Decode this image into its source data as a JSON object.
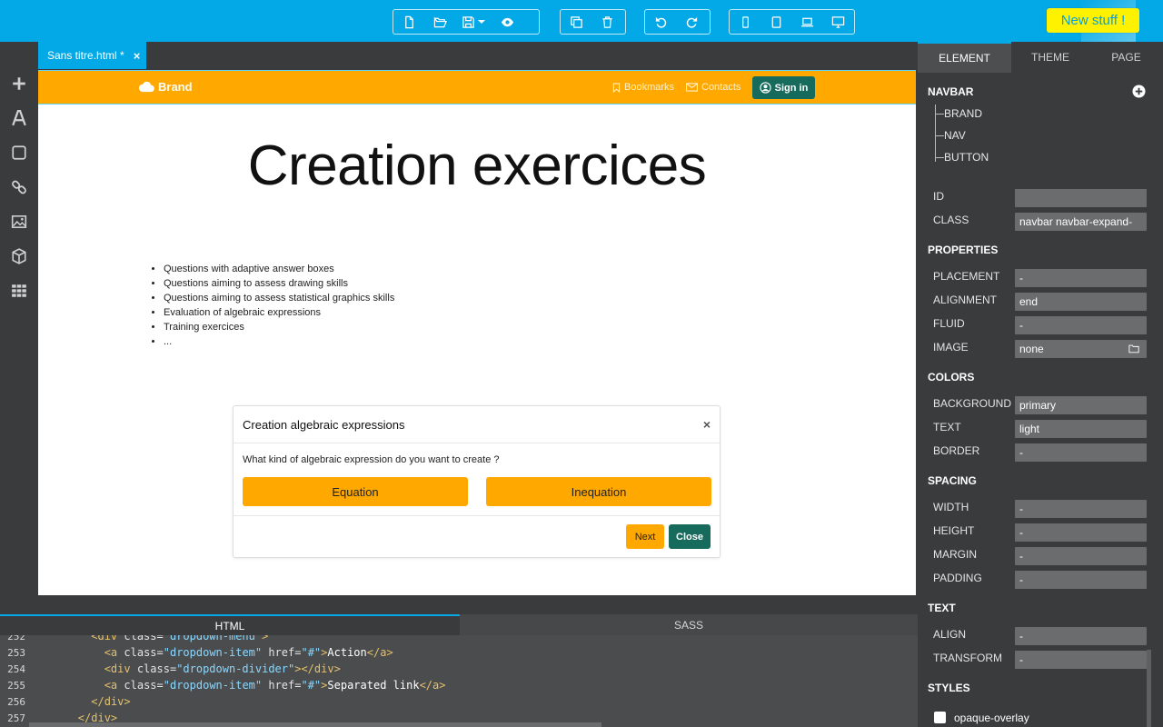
{
  "toolbar": {
    "new_stuff": "New stuff !"
  },
  "file_tab": {
    "name": "Sans titre.html *",
    "close": "×"
  },
  "navbar": {
    "brand": "Brand",
    "links": [
      "Bookmarks",
      "Contacts"
    ],
    "signin": "Sign in"
  },
  "hero": {
    "title": "Creation exercices"
  },
  "bullets": [
    "Questions with adaptive answer boxes",
    "Questions aiming to assess drawing skills",
    "Questions aiming to assess statistical graphics skills",
    "Evaluation of algebraic expressions",
    "Training exercices",
    "..."
  ],
  "modal": {
    "title": "Creation algebraic expressions",
    "close": "×",
    "question": "What kind of algebraic expression do you want to create ?",
    "choices": [
      "Equation",
      "Inequation"
    ],
    "next": "Next",
    "close_btn": "Close"
  },
  "editor": {
    "tabs": [
      "HTML",
      "SASS"
    ],
    "lines": [
      {
        "n": "252",
        "indent": "          ",
        "parts": [
          [
            "tag",
            "<div "
          ],
          [
            "attr",
            "class="
          ],
          [
            "str",
            "\"dropdown-menu\""
          ],
          [
            "tag",
            ">"
          ]
        ]
      },
      {
        "n": "253",
        "indent": "            ",
        "parts": [
          [
            "tag",
            "<a "
          ],
          [
            "attr",
            "class="
          ],
          [
            "str",
            "\"dropdown-item\""
          ],
          [
            "attr",
            " href="
          ],
          [
            "str",
            "\"#\""
          ],
          [
            "tag",
            ">"
          ],
          [
            "txt",
            "Action"
          ],
          [
            "tag",
            "</a>"
          ]
        ]
      },
      {
        "n": "254",
        "indent": "            ",
        "parts": [
          [
            "tag",
            "<div "
          ],
          [
            "attr",
            "class="
          ],
          [
            "str",
            "\"dropdown-divider\""
          ],
          [
            "tag",
            "></div>"
          ]
        ]
      },
      {
        "n": "255",
        "indent": "            ",
        "parts": [
          [
            "tag",
            "<a "
          ],
          [
            "attr",
            "class="
          ],
          [
            "str",
            "\"dropdown-item\""
          ],
          [
            "attr",
            " href="
          ],
          [
            "str",
            "\"#\""
          ],
          [
            "tag",
            ">"
          ],
          [
            "txt",
            "Separated link"
          ],
          [
            "tag",
            "</a>"
          ]
        ]
      },
      {
        "n": "256",
        "indent": "          ",
        "parts": [
          [
            "tag",
            "</div>"
          ]
        ]
      },
      {
        "n": "257",
        "indent": "        ",
        "parts": [
          [
            "tag",
            "</div>"
          ]
        ]
      }
    ]
  },
  "panel": {
    "tabs": [
      "ELEMENT",
      "THEME",
      "PAGE"
    ],
    "navbar_title": "NAVBAR",
    "tree": [
      "BRAND",
      "NAV",
      "BUTTON"
    ],
    "id_label": "ID",
    "id_value": "",
    "class_label": "CLASS",
    "class_value": "navbar navbar-expand-",
    "properties_title": "PROPERTIES",
    "placement_label": "PLACEMENT",
    "placement_value": "-",
    "alignment_label": "ALIGNMENT",
    "alignment_value": "end",
    "fluid_label": "FLUID",
    "fluid_value": "-",
    "image_label": "IMAGE",
    "image_value": "none",
    "colors_title": "COLORS",
    "background_label": "BACKGROUND",
    "background_value": "primary",
    "text_label": "TEXT",
    "text_value": "light",
    "border_label": "BORDER",
    "border_value": "-",
    "spacing_title": "SPACING",
    "width_label": "WIDTH",
    "width_value": "-",
    "height_label": "HEIGHT",
    "height_value": "-",
    "margin_label": "MARGIN",
    "margin_value": "-",
    "padding_label": "PADDING",
    "padding_value": "-",
    "text_title": "TEXT",
    "align_label": "ALIGN",
    "align_value": "-",
    "transform_label": "TRANSFORM",
    "transform_value": "-",
    "styles_title": "STYLES",
    "style_option": "opaque-overlay"
  },
  "colors": {
    "toolbar": "#03a9e7",
    "primary": "#ffa800",
    "dark_button": "#166b5c",
    "panel": "#3a3b3d"
  }
}
